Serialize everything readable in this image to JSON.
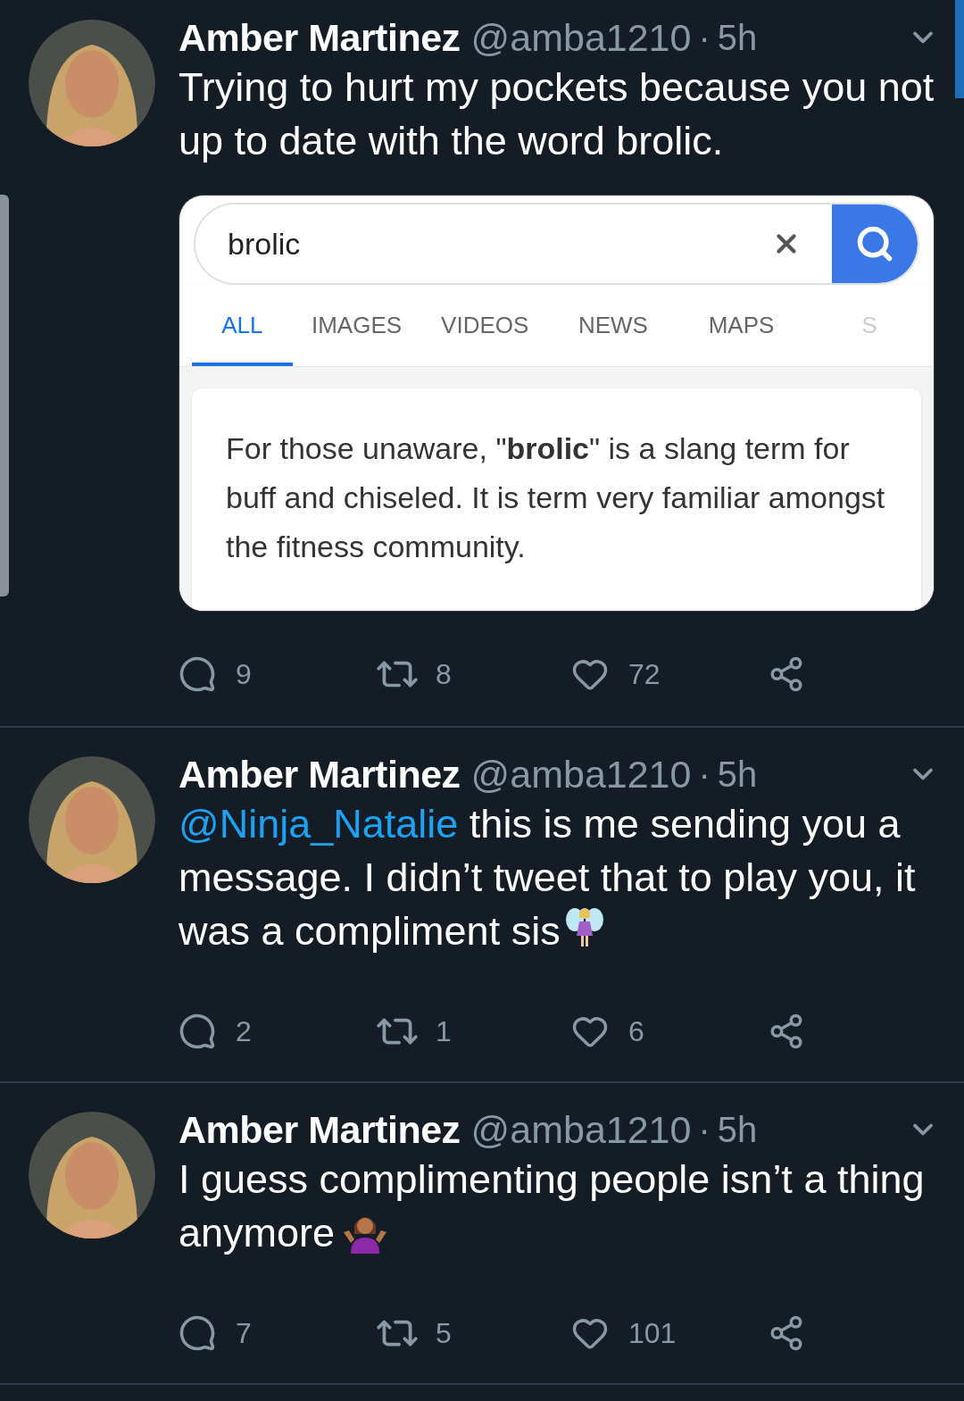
{
  "tweets": [
    {
      "name": "Amber Martinez",
      "handle": "@amba1210",
      "separator": "·",
      "time": "5h",
      "text": "Trying to hurt my pockets because you not up to date with the word brolic.",
      "card": {
        "query": "brolic",
        "tabs": [
          {
            "label": "ALL",
            "selected": true
          },
          {
            "label": "IMAGES",
            "selected": false
          },
          {
            "label": "VIDEOS",
            "selected": false
          },
          {
            "label": "NEWS",
            "selected": false
          },
          {
            "label": "MAPS",
            "selected": false
          },
          {
            "label": "S",
            "selected": false
          }
        ],
        "snippet": "For those unaware, \"**brolic**\" is a slang term for buff and chiseled. It is term very familiar amongst the fitness community."
      },
      "replies": "9",
      "retweets": "8",
      "likes": "72"
    },
    {
      "name": "Amber Martinez",
      "handle": "@amba1210",
      "separator": "·",
      "time": "5h",
      "mention": "@Ninja_Natalie",
      "text": "this is me sending you a message. I didn’t tweet that to play you, it was a compliment sis",
      "emoji": {
        "kind": "fairy"
      },
      "replies": "2",
      "retweets": "1",
      "likes": "6"
    },
    {
      "name": "Amber Martinez",
      "handle": "@amba1210",
      "separator": "·",
      "time": "5h",
      "text": "I guess complimenting people isn’t a thing anymore",
      "emoji": {
        "kind": "shrug"
      },
      "replies": "7",
      "retweets": "5",
      "likes": "101"
    }
  ]
}
